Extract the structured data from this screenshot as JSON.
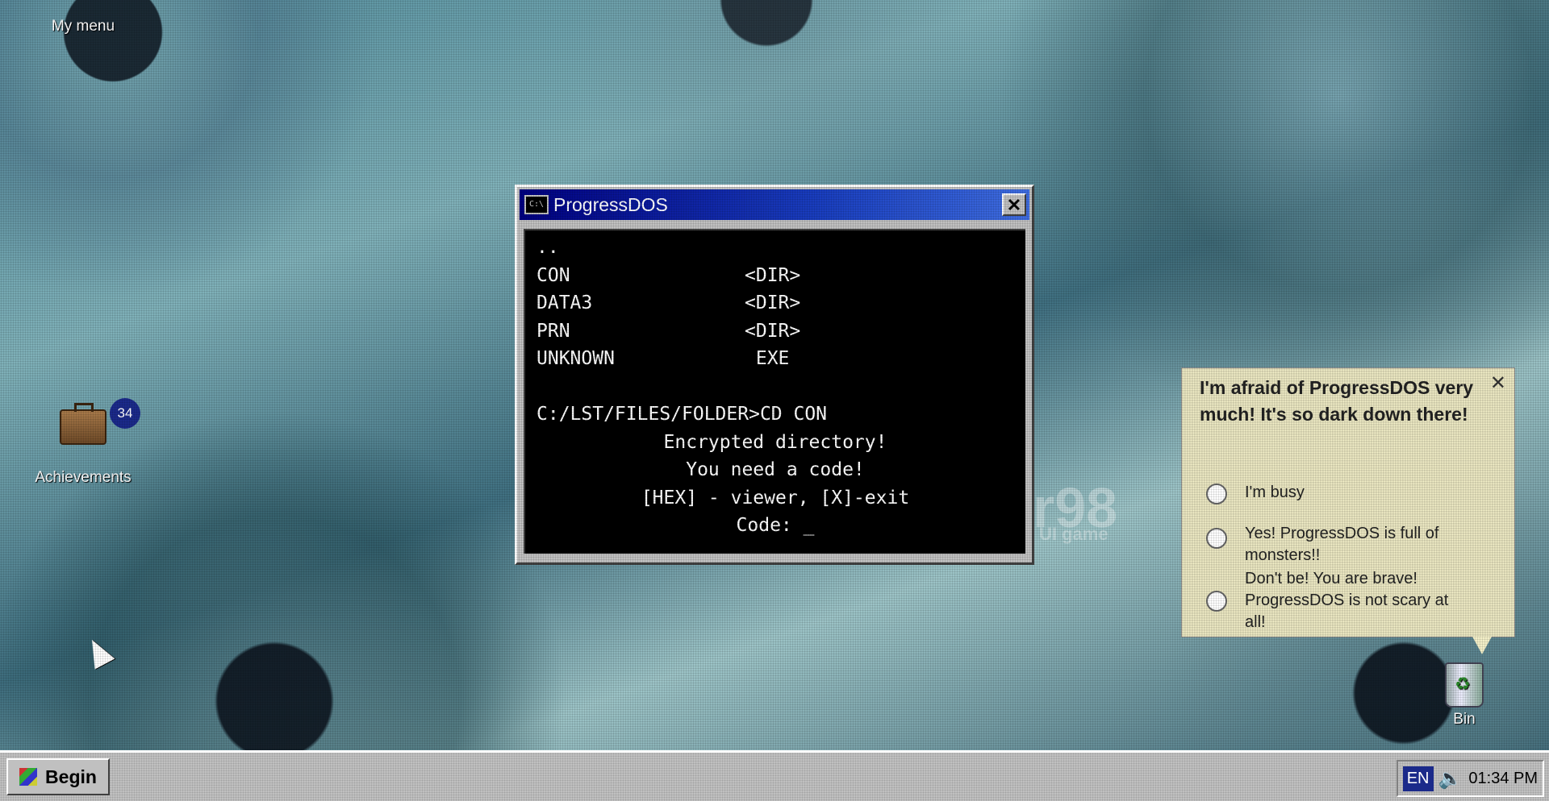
{
  "desktop": {
    "icons": [
      {
        "label": "My menu"
      },
      {
        "label": "Achievements",
        "badge": "34"
      },
      {
        "label": "Bin"
      }
    ],
    "watermark": {
      "title": "r98",
      "subtitle": "UI game"
    }
  },
  "window": {
    "title": "ProgressDOS",
    "icon_text": "C:\\",
    "close_label": "✕",
    "console": {
      "listing": [
        {
          "name": "..",
          "type": ""
        },
        {
          "name": "CON",
          "type": "<DIR>"
        },
        {
          "name": "DATA3",
          "type": "<DIR>"
        },
        {
          "name": "PRN",
          "type": "<DIR>"
        },
        {
          "name": "UNKNOWN",
          "type": " EXE"
        }
      ],
      "prompt": "C:/LST/FILES/FOLDER>CD CON",
      "message_1": "Encrypted directory!",
      "message_2": "You need a code!",
      "message_3": "[HEX] - viewer, [X]-exit",
      "code_prompt": "Code: _"
    }
  },
  "popup": {
    "question": "I'm afraid of ProgressDOS very much! It's so dark down there!",
    "close_label": "✕",
    "options": [
      {
        "label": "I'm busy"
      },
      {
        "label": "Yes! ProgressDOS is full of monsters!!"
      },
      {
        "label": "Don't be! You are brave! ProgressDOS is not scary at all!"
      }
    ]
  },
  "taskbar": {
    "start_label": "Begin",
    "language": "EN",
    "clock": "01:34 PM"
  }
}
